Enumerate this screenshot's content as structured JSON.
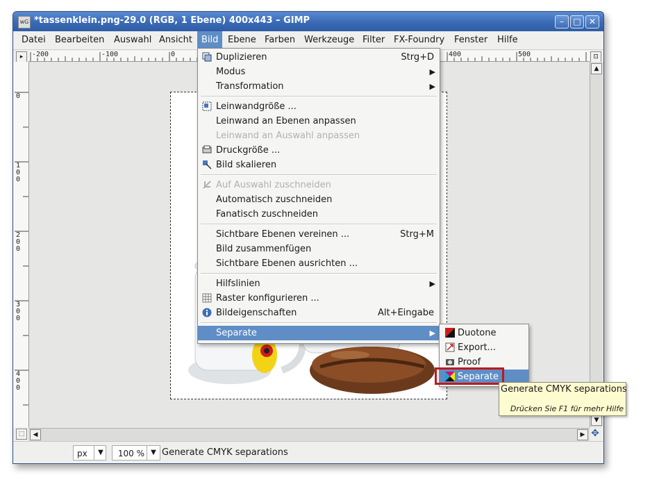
{
  "window": {
    "title": "*tassenklein.png-29.0 (RGB, 1 Ebene) 400x443 – GIMP",
    "app_icon_text": "wG",
    "minimize_icon": "minimize-icon",
    "maximize_icon": "maximize-icon",
    "close_icon": "close-icon",
    "minimize_glyph": "–",
    "maximize_glyph": "□",
    "close_glyph": "✕"
  },
  "menubar": [
    "Datei",
    "Bearbeiten",
    "Auswahl",
    "Ansicht",
    "Bild",
    "Ebene",
    "Farben",
    "Werkzeuge",
    "Filter",
    "FX-Foundry",
    "Fenster",
    "Hilfe"
  ],
  "ruler": {
    "h_labels": [
      "-200",
      "-100",
      "0",
      "400",
      "500"
    ],
    "v_labels": [
      "0",
      "1\n0\n0",
      "2\n0\n0",
      "3\n0\n0",
      "4\n0\n0"
    ]
  },
  "bild_menu": {
    "items": [
      {
        "label": "Duplizieren",
        "accel": "Strg+D",
        "icon": "duplicate-icon"
      },
      {
        "label": "Modus",
        "submenu": true
      },
      {
        "label": "Transformation",
        "submenu": true
      },
      {
        "label": "Leinwandgröße ...",
        "icon": "canvas-size-icon"
      },
      {
        "label": "Leinwand an Ebenen anpassen"
      },
      {
        "label": "Leinwand an Auswahl anpassen",
        "disabled": true
      },
      {
        "label": "Druckgröße ...",
        "icon": "print-size-icon"
      },
      {
        "label": "Bild skalieren",
        "icon": "scale-image-icon"
      },
      {
        "label": "Auf Auswahl zuschneiden",
        "disabled": true,
        "icon": "crop-icon"
      },
      {
        "label": "Automatisch zuschneiden"
      },
      {
        "label": "Fanatisch zuschneiden"
      },
      {
        "label": "Sichtbare Ebenen vereinen ...",
        "accel": "Strg+M"
      },
      {
        "label": "Bild zusammenfügen"
      },
      {
        "label": "Sichtbare Ebenen ausrichten ..."
      },
      {
        "label": "Hilfslinien",
        "submenu": true
      },
      {
        "label": "Raster konfigurieren ...",
        "icon": "grid-icon"
      },
      {
        "label": "Bildeigenschaften",
        "accel": "Alt+Eingabe",
        "icon": "info-icon"
      },
      {
        "label": "Separate",
        "submenu": true,
        "highlighted": true
      }
    ]
  },
  "separate_submenu": {
    "items": [
      {
        "label": "Duotone",
        "icon": "duotone-icon"
      },
      {
        "label": "Export...",
        "icon": "export-icon"
      },
      {
        "label": "Proof",
        "icon": "proof-icon"
      },
      {
        "label": "Separate",
        "icon": "cmyk-separate-icon",
        "highlighted": true
      }
    ]
  },
  "tooltip": {
    "text": "Generate CMYK separations",
    "help": "Drücken Sie F1 für mehr Hilfe"
  },
  "statusbar": {
    "unit": "px",
    "zoom": "100 %",
    "message": "Generate CMYK separations"
  },
  "colors": {
    "highlight": "#5f8ec6",
    "titlebar": "#3a6ab5",
    "annotation_box": "#c01818",
    "tooltip_bg": "#fdfbd0"
  }
}
